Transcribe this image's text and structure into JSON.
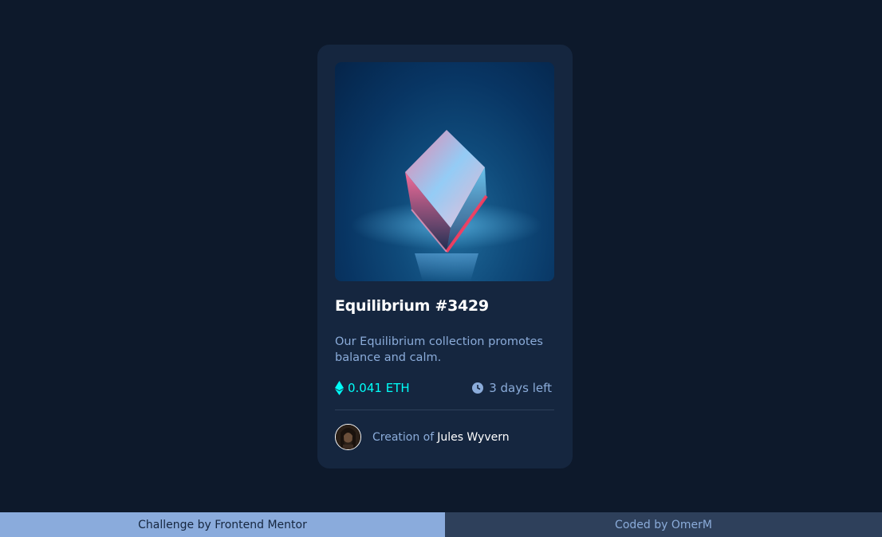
{
  "card": {
    "image_alt": "equilibrium cube",
    "title": "Equilibrium #3429",
    "description": "Our Equilibrium collection promotes balance and calm.",
    "price": "0.041 ETH",
    "time_left": "3 days left",
    "creation_label": "Creation of",
    "creator_name": "Jules Wyvern",
    "icons": {
      "price": "ethereum-icon",
      "time": "clock-icon"
    }
  },
  "footer": {
    "left_text": "Challenge by Frontend Mentor",
    "right_text": "Coded by OmerM"
  },
  "colors": {
    "background": "#0d192b",
    "card": "#15263f",
    "cyan": "#00fff8",
    "soft_blue": "#8bacda",
    "white": "#ffffff",
    "line": "#2e405a"
  }
}
